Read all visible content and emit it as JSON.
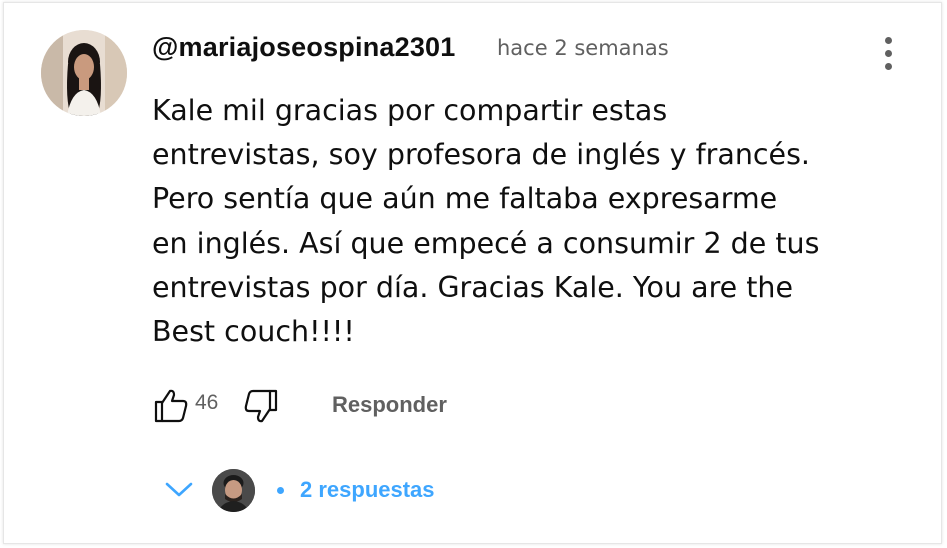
{
  "comment": {
    "author": "@mariajoseospina2301",
    "time": "hace 2 semanas",
    "text": "Kale mil gracias por compartir estas\nentrevistas, soy profesora de inglés y francés.\nPero sentía que aún me faltaba expresarme\nen inglés. Así que empecé a consumir 2 de tus\nentrevistas por día. Gracias Kale. You are the\nBest couch!!!!",
    "like_count": "46",
    "reply_label": "Responder"
  },
  "replies": {
    "label": "2 respuestas"
  },
  "icons": {
    "avatar": "user-avatar",
    "more": "more-vert-icon",
    "like": "thumb-up-icon",
    "dislike": "thumb-down-icon",
    "expand": "chevron-down-icon",
    "reply_avatar": "replier-avatar"
  },
  "colors": {
    "text": "#0f0f0f",
    "secondary": "#606060",
    "link": "#3ea6ff",
    "background": "#ffffff"
  }
}
